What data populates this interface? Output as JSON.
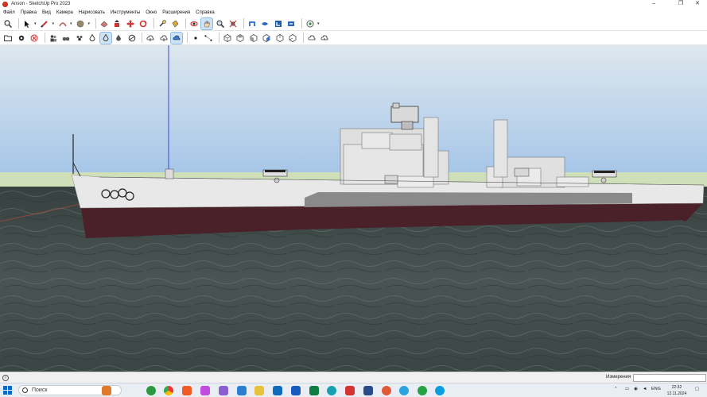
{
  "window": {
    "title": "Anson - SketchUp Pro 2023",
    "minimize_glyph": "–",
    "maximize_glyph": "❐",
    "close_glyph": "✕"
  },
  "menu": [
    "Файл",
    "Правка",
    "Вид",
    "Камера",
    "Нарисовать",
    "Инструменты",
    "Окно",
    "Расширения",
    "Справка"
  ],
  "toolbar_row_1": {
    "icons": [
      "zoom-window-icon",
      "select-arrow-icon",
      "pencil-line-icon",
      "freehand-arc-icon",
      "paint-sphere-icon",
      "eraser-icon",
      "push-pull-icon",
      "move-icon",
      "rotate-icon",
      "tape-measure-icon",
      "paint-bucket-icon",
      "orbit-icon",
      "pan-hand-icon",
      "zoom-icon",
      "zoom-extents-icon",
      "warehouse-icon",
      "extension-warehouse-icon",
      "layout-icon",
      "send-to-layout-icon",
      "add-location-icon"
    ]
  },
  "toolbar_row_2": {
    "icons": [
      "open-folder-icon",
      "settings-gear-icon",
      "cancel-circle-icon",
      "people-icon",
      "camera-binoculars-icon",
      "team-icon",
      "xray-drop-icon",
      "back-edges-drop-icon",
      "wireframe-icon",
      "shaded-icon",
      "cloud-upload-icon",
      "cloud-download-icon",
      "cloud-sync-icon",
      "dot-icon",
      "line-dots-icon",
      "iso-view-icon",
      "top-view-icon",
      "front-view-icon",
      "right-view-icon",
      "back-view-icon",
      "left-view-icon",
      "cloud-a-icon",
      "cloud-b-icon"
    ]
  },
  "colors": {
    "sky_top": "#dbe6ee",
    "sky_bottom": "#a8c8e8",
    "ground": "#cfe0b8",
    "water": "#3f4b48",
    "hull_white": "#e8e8e8",
    "hull_maroon": "#4a2029",
    "axis_blue": "#3d46c9",
    "axis_red": "#c94a3d"
  },
  "status_bar": {
    "measurements_label": "Измерения",
    "measurements_value": ""
  },
  "taskbar": {
    "search_label": "Поиск",
    "apps": [
      "app-1-icon",
      "app-2-icon",
      "chrome-icon",
      "brave-icon",
      "app-5-icon",
      "app-6-icon",
      "app-7-icon",
      "app-8-icon",
      "outlook-icon",
      "word-icon",
      "excel-icon",
      "edge-icon",
      "app-13-icon",
      "app-14-icon",
      "app-15-icon",
      "telegram-icon",
      "whatsapp-icon",
      "skype-icon"
    ],
    "language": "ENG",
    "time": "22:32",
    "date": "12.11.2024"
  }
}
